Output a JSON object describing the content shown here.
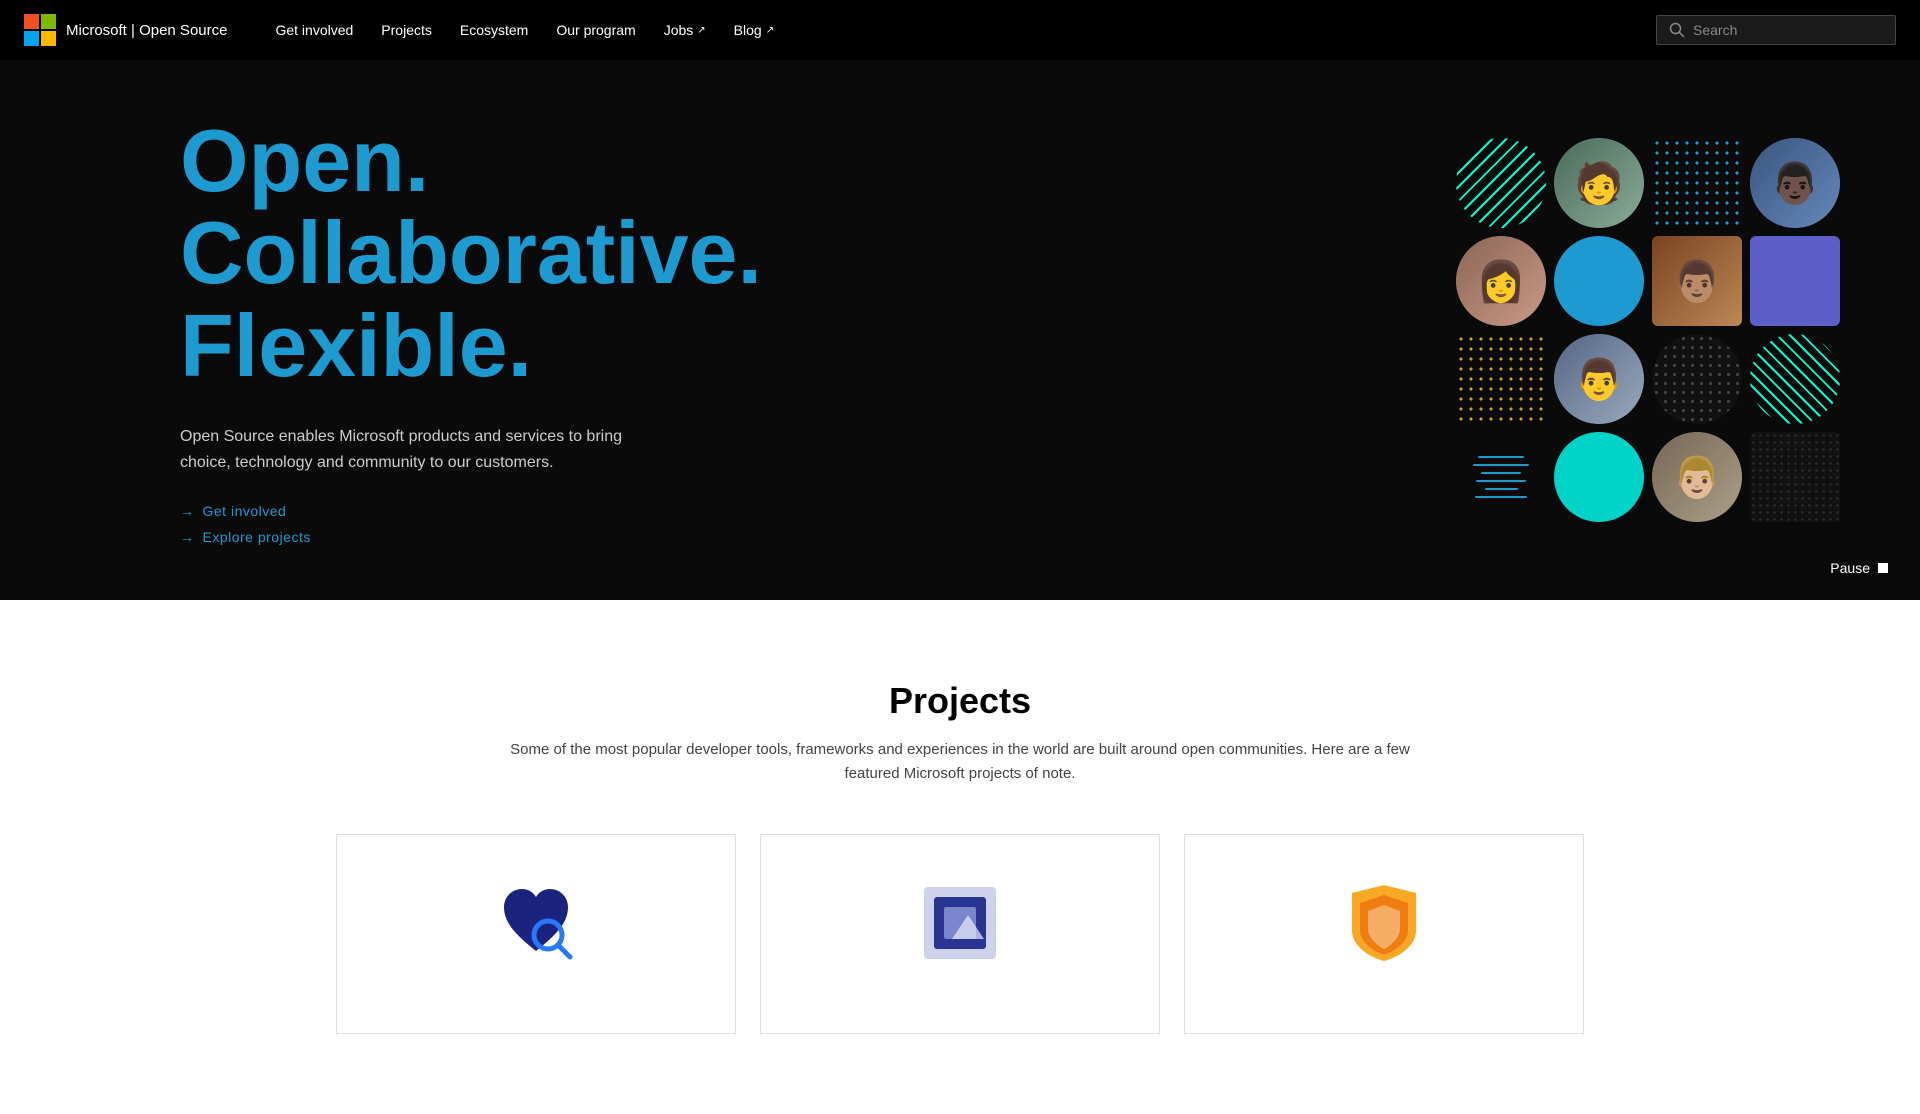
{
  "nav": {
    "logo_text": "Microsoft | Open Source",
    "links": [
      {
        "label": "Get involved",
        "href": "#",
        "external": false
      },
      {
        "label": "Projects",
        "href": "#",
        "external": false
      },
      {
        "label": "Ecosystem",
        "href": "#",
        "external": false
      },
      {
        "label": "Our program",
        "href": "#",
        "external": false
      },
      {
        "label": "Jobs",
        "href": "#",
        "external": true
      },
      {
        "label": "Blog",
        "href": "#",
        "external": true
      }
    ],
    "search_placeholder": "Search"
  },
  "hero": {
    "headline_line1": "Open.",
    "headline_line2": "Collaborative.",
    "headline_line3": "Flexible.",
    "description": "Open Source enables Microsoft products and services to bring choice, technology and community to our customers.",
    "cta_links": [
      {
        "label": "Get involved",
        "href": "#"
      },
      {
        "label": "Explore projects",
        "href": "#"
      }
    ],
    "pause_label": "Pause"
  },
  "projects_section": {
    "title": "Projects",
    "subtitle": "Some of the most popular developer tools, frameworks and experiences in the world are built around open communities. Here are a few featured Microsoft projects of note.",
    "cards": [
      {
        "id": "dep-review",
        "icon_type": "dep-review"
      },
      {
        "id": "fluid",
        "icon_type": "fluid"
      },
      {
        "id": "ospo",
        "icon_type": "ospo"
      }
    ]
  }
}
